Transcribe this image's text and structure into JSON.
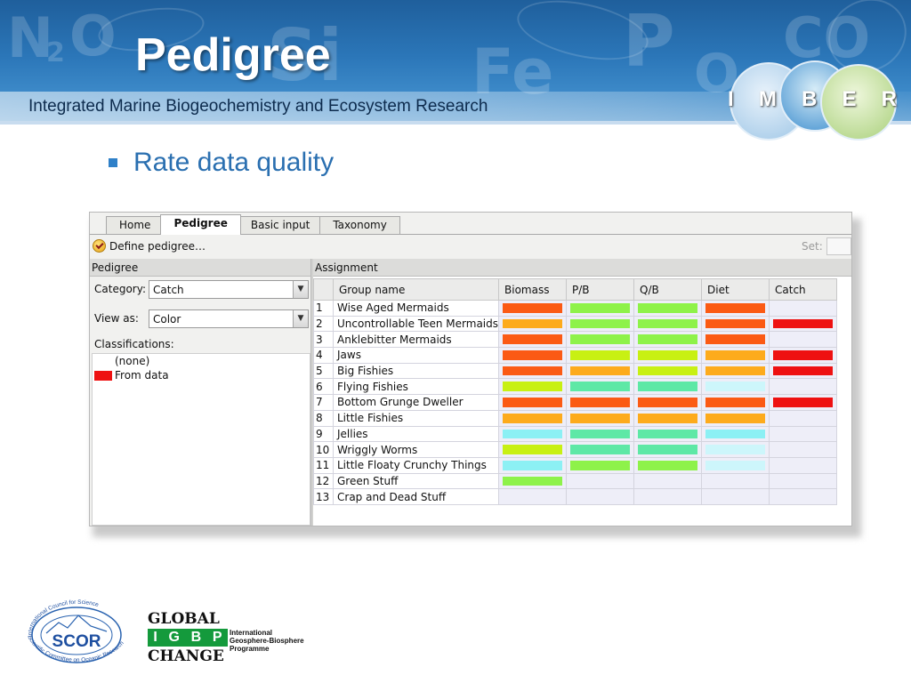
{
  "slide": {
    "title": "Pedigree",
    "subtitle": "Integrated Marine Biogeochemistry and Ecosystem Research",
    "banner_ghost_letters": [
      "N",
      "2",
      "O",
      "Si",
      "Fe",
      "P",
      "O",
      "CO"
    ],
    "imber_letters": [
      "I",
      "M",
      "B",
      "E",
      "R"
    ],
    "bullet": "Rate data quality",
    "accent": "#2f80c8"
  },
  "app": {
    "tabs": [
      "Home",
      "Pedigree",
      "Basic input",
      "Taxonomy"
    ],
    "active_tab": "Pedigree",
    "toolbar": {
      "define_label": "Define pedigree…",
      "set_label": "Set:",
      "set_value": ""
    },
    "left_panel": {
      "header": "Pedigree",
      "category_label": "Category:",
      "category_value": "Catch",
      "view_label": "View as:",
      "view_value": "Color",
      "classifications_label": "Classifications:",
      "classifications": [
        {
          "label": "(none)",
          "color": "#ffffff"
        },
        {
          "label": "From data",
          "color": "#ee1111"
        }
      ]
    },
    "assignment": {
      "header": "Assignment",
      "columns": [
        "Group name",
        "Biomass",
        "P/B",
        "Q/B",
        "Diet",
        "Catch"
      ],
      "palette": {
        "red": "#ee1111",
        "orange_red": "#fb5a14",
        "orange": "#fdab1c",
        "yellow_green": "#c8f013",
        "green": "#8ef24a",
        "teal": "#5ee8a6",
        "cyan": "#8cf0f4",
        "pale_cyan": "#cdf6fb",
        "empty": "#eeeef8"
      },
      "rows": [
        {
          "num": "1",
          "name": "Wise Aged Mermaids",
          "cells": [
            "orange_red",
            "green",
            "green",
            "orange_red",
            "empty"
          ]
        },
        {
          "num": "2",
          "name": "Uncontrollable Teen Mermaids",
          "cells": [
            "orange",
            "green",
            "green",
            "orange_red",
            "red"
          ]
        },
        {
          "num": "3",
          "name": "Anklebitter Mermaids",
          "cells": [
            "orange_red",
            "green",
            "green",
            "orange_red",
            "empty"
          ]
        },
        {
          "num": "4",
          "name": "Jaws",
          "cells": [
            "orange_red",
            "yellow_green",
            "yellow_green",
            "orange",
            "red"
          ]
        },
        {
          "num": "5",
          "name": "Big Fishies",
          "cells": [
            "orange_red",
            "orange",
            "yellow_green",
            "orange",
            "red"
          ]
        },
        {
          "num": "6",
          "name": "Flying Fishies",
          "cells": [
            "yellow_green",
            "teal",
            "teal",
            "pale_cyan",
            "empty"
          ]
        },
        {
          "num": "7",
          "name": "Bottom Grunge Dweller",
          "cells": [
            "orange_red",
            "orange_red",
            "orange_red",
            "orange_red",
            "red"
          ]
        },
        {
          "num": "8",
          "name": "Little Fishies",
          "cells": [
            "orange",
            "orange",
            "orange",
            "orange",
            "empty"
          ]
        },
        {
          "num": "9",
          "name": "Jellies",
          "cells": [
            "cyan",
            "teal",
            "teal",
            "cyan",
            "empty"
          ]
        },
        {
          "num": "10",
          "name": "Wriggly Worms",
          "cells": [
            "yellow_green",
            "teal",
            "teal",
            "pale_cyan",
            "empty"
          ]
        },
        {
          "num": "11",
          "name": "Little Floaty Crunchy Things",
          "cells": [
            "cyan",
            "green",
            "green",
            "pale_cyan",
            "empty"
          ]
        },
        {
          "num": "12",
          "name": "Green Stuff",
          "cells": [
            "green",
            "empty",
            "empty",
            "empty",
            "empty"
          ]
        },
        {
          "num": "13",
          "name": "Crap and Dead Stuff",
          "cells": [
            "empty",
            "empty",
            "empty",
            "empty",
            "empty"
          ]
        }
      ]
    }
  },
  "footer": {
    "scor": {
      "top_arc": "International Council for Science",
      "name": "SCOR",
      "bottom_arc": "Scientific Committee on Oceanic Research"
    },
    "igbp": {
      "line1": "GLOBAL",
      "letters": [
        "I",
        "G",
        "B",
        "P"
      ],
      "line3": "CHANGE",
      "program": [
        "International",
        "Geosphere-Biosphere",
        "Programme"
      ]
    }
  }
}
